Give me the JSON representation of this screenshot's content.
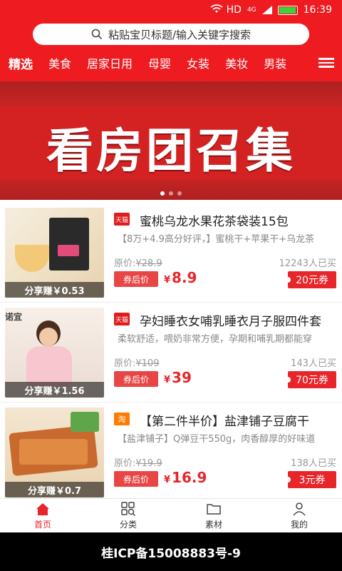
{
  "status": {
    "network": "HD",
    "signal_tag": "4G",
    "time": "16:39",
    "battery_level": 0.9
  },
  "search": {
    "placeholder": "粘贴宝贝标题/输入关键字搜索"
  },
  "categories": [
    "精选",
    "美食",
    "居家日用",
    "母婴",
    "女装",
    "美妆",
    "男装"
  ],
  "banner": {
    "title": "看房团召集",
    "slides": 3,
    "active_slide": 1
  },
  "products": [
    {
      "platform": "天猫",
      "title": "蜜桃乌龙水果花茶袋装15包",
      "desc": "【8万+4.9高分好评，】蜜桃干+苹果干+乌龙茶",
      "orig_label": "原价:",
      "orig_price": "¥28.9",
      "sold": "12243人已买",
      "after_label": "券后价",
      "price_symbol": "¥",
      "price": "8.9",
      "coupon": "20元券",
      "share": "分享赚￥0.53"
    },
    {
      "platform": "天猫",
      "title": "孕妇睡衣女哺乳睡衣月子服四件套",
      "desc": "柔软舒适，喂奶非常方便，孕期和哺乳期都能穿",
      "orig_label": "原价:",
      "orig_price": "¥109",
      "sold": "143人已买",
      "after_label": "券后价",
      "price_symbol": "¥",
      "price": "39",
      "coupon": "70元券",
      "share": "分享赚￥1.56"
    },
    {
      "platform": "淘",
      "title": "【第二件半价】盐津铺子豆腐干",
      "desc": "【盐津铺子】Q弹豆干550g，肉香醇厚的好味道",
      "orig_label": "原价:",
      "orig_price": "¥19.9",
      "sold": "138人已买",
      "after_label": "券后价",
      "price_symbol": "¥",
      "price": "16.9",
      "coupon": "3元券",
      "share": "分享赚￥0.7"
    }
  ],
  "tabs": [
    {
      "label": "首页",
      "icon": "home-icon"
    },
    {
      "label": "分类",
      "icon": "grid-search-icon"
    },
    {
      "label": "素材",
      "icon": "folder-icon"
    },
    {
      "label": "我的",
      "icon": "user-icon"
    }
  ],
  "footer": {
    "icp": "桂ICP备15008883号-9"
  },
  "colors": {
    "brand_red": "#ee1b20",
    "price_red": "#e8262a"
  }
}
